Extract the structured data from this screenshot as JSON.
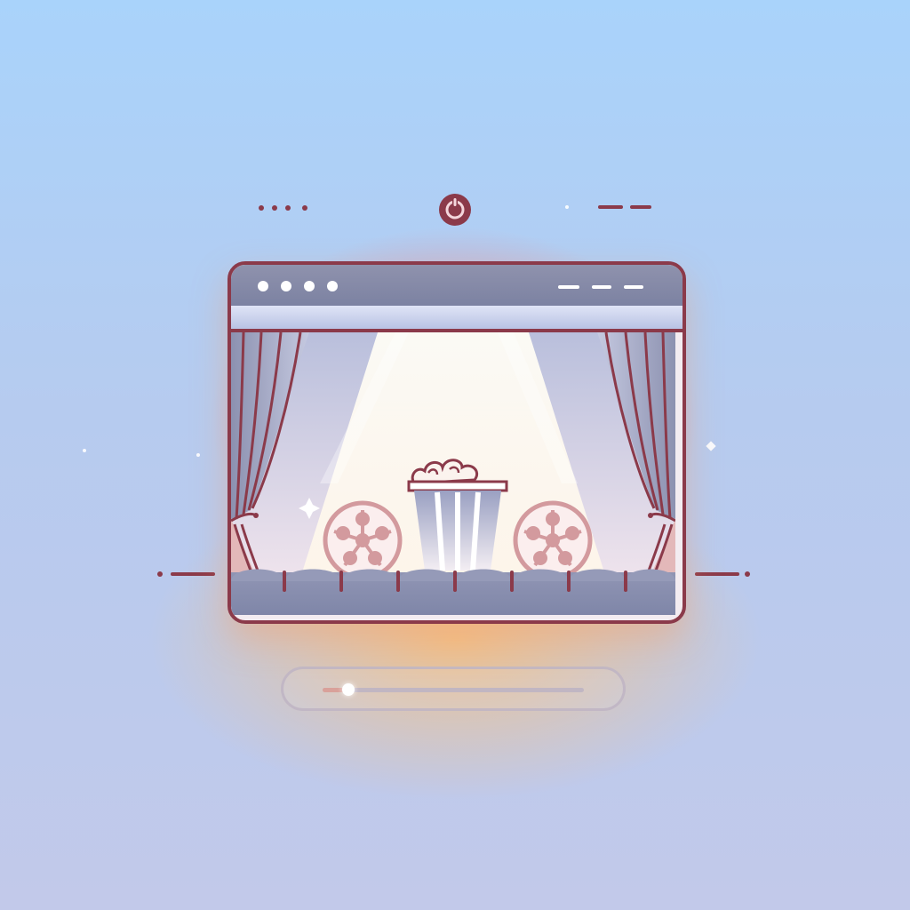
{
  "colors": {
    "outline": "#8b3a4a",
    "titlebar": "#7c82a2",
    "spotlight": "#fff6e8",
    "seat": "#8a8fae",
    "sky_top": "#a9d3fb",
    "glow_red": "#ff6e6e",
    "glow_orange": "#ffbe6e"
  },
  "icons": {
    "top_center": "power-icon",
    "window_controls": [
      "window-dot",
      "window-dot",
      "window-dot",
      "window-dot"
    ],
    "stage": [
      "curtain-left-icon",
      "curtain-right-icon",
      "spotlight-icon",
      "popcorn-icon",
      "film-reel-icon",
      "film-reel-icon",
      "theater-seats-icon"
    ]
  },
  "player": {
    "progress": 0.1
  }
}
